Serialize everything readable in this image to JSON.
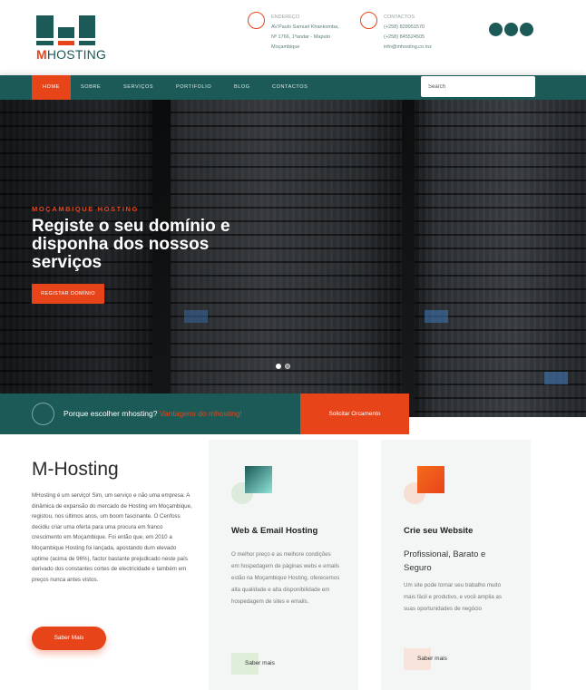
{
  "header": {
    "logo": {
      "letter": "M",
      "word": "HOSTING"
    },
    "address": {
      "title": "ENDEREÇO",
      "lines": [
        "AV.Paulo Samuel Khankomba,",
        "Nº 1766, 1ºandar - Maputo",
        "Moçambique"
      ]
    },
    "contacts": {
      "title": "CONTACTOS",
      "lines": [
        "(+258) 828951570",
        "(+258) 845524505",
        "info@mhosting.co.mz"
      ]
    },
    "socials": [
      "social-icon-1",
      "social-icon-2",
      "social-icon-3"
    ]
  },
  "nav": {
    "items": [
      "HOME",
      "SOBRE",
      "SERVIÇOS",
      "PORTIFOLIO",
      "BLOG",
      "CONTACTOS"
    ],
    "active": "HOME",
    "search_placeholder": "Search"
  },
  "hero": {
    "kicker": "MOÇAMBIQUE HOSTING",
    "headline": "Registe o seu domínio e disponha dos nossos serviços",
    "cta": "REGISTAR DOMÍNIO",
    "slides": 2,
    "active_slide": 1
  },
  "why": {
    "question": "Porque escolher mhosting?",
    "highlight": "Vantagens do mhosting!",
    "button": "Solicitar Orcamento"
  },
  "about": {
    "title": "M-Hosting",
    "text": "MHosting é um serviço! Sim, um serviço e não uma empresa. A dinâmica de expansão do mercado de Hosting em Moçambique, registou, nos últimos anos, um boom fascinante. O Cenfoss decidiu criar uma oferta para uma procura em franco crescimento em Moçambique. Foi então que, em 2010 a Moçambique Hosting foi lançada, apostando dum elevado uptime (acima de 96%), factor bastante prejudicado neste país derivado dos constantes cortes de electricidade e também em preços nunca antes vistos.",
    "button": "Saber Mais"
  },
  "services": [
    {
      "title": "Web & Email Hosting",
      "subtitle": "",
      "text": "O melhor preço e as melhore condições em hospedagem de páginas webs e emails estão na Moçambique Hosting, oferecemos alta qualidade e alta disponibilidade em hospedagem de sites e emails.",
      "button": "Saber mais",
      "accent": "#1c5a57"
    },
    {
      "title": "Crie seu Website",
      "subtitle": "Profissional, Barato e Seguro",
      "text": "Um site pode tornar seu trabalho muito mais fácil e produtivo, e você amplia as suas oportunidades de negócio",
      "button": "Saber mais",
      "accent": "#e8441a"
    }
  ],
  "colors": {
    "primary": "#1c5a57",
    "accent": "#e8441a"
  }
}
